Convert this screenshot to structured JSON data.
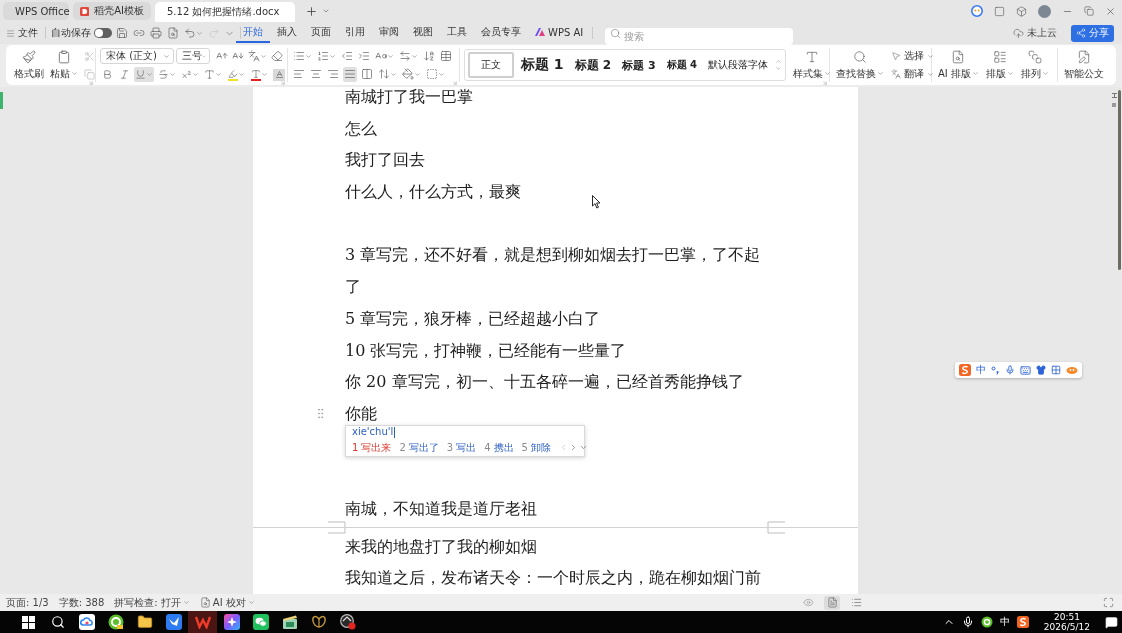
{
  "title_bar": {
    "tabs": [
      {
        "label": "WPS Office",
        "kind": "wps",
        "selected": false
      },
      {
        "label": "稻壳AI模板",
        "kind": "docer",
        "selected": false
      },
      {
        "label": "5.12 如何把握情绪.docx",
        "kind": "writer",
        "selected": true
      }
    ]
  },
  "quick_bar": {
    "file_menu": "文件",
    "autosave": {
      "label": "自动保存",
      "on": false
    },
    "history": [
      {
        "kind": "undo",
        "disabled": false
      },
      {
        "kind": "redo",
        "disabled": true
      }
    ]
  },
  "ribbon_tabs": [
    {
      "label": "开始",
      "kind": "text",
      "selected": true
    },
    {
      "label": "插入",
      "kind": "text",
      "selected": false
    },
    {
      "label": "页面",
      "kind": "text",
      "selected": false
    },
    {
      "label": "引用",
      "kind": "text",
      "selected": false
    },
    {
      "label": "审阅",
      "kind": "text",
      "selected": false
    },
    {
      "label": "视图",
      "kind": "text",
      "selected": false
    },
    {
      "label": "工具",
      "kind": "text",
      "selected": false
    },
    {
      "label": "会员专享",
      "kind": "text",
      "selected": false
    },
    {
      "label": "WPS AI",
      "kind": "ai",
      "selected": false
    }
  ],
  "search": {
    "placeholder": "搜索"
  },
  "cloud_status": "未上云",
  "share_button": "分享",
  "ribbon": {
    "clipboard": {
      "format_painter": "格式刷",
      "paste": "粘贴"
    },
    "font": {
      "family": "宋体 (正文)",
      "size": "三号",
      "toggles": [
        {
          "kind": "bold",
          "on": false
        },
        {
          "kind": "italic",
          "on": false
        },
        {
          "kind": "underline",
          "on": true
        }
      ]
    },
    "alignment": [
      {
        "kind": "left",
        "selected": false
      },
      {
        "kind": "center",
        "selected": false
      },
      {
        "kind": "right",
        "selected": false
      },
      {
        "kind": "justify",
        "selected": true
      },
      {
        "kind": "distributed",
        "selected": false
      }
    ],
    "styles": [
      {
        "label": "正文",
        "kind": "body",
        "selected": true
      },
      {
        "label": "标题 1",
        "kind": "heading1",
        "selected": false
      },
      {
        "label": "标题 2",
        "kind": "heading2",
        "selected": false
      },
      {
        "label": "标题 3",
        "kind": "heading3",
        "selected": false
      },
      {
        "label": "标题 4",
        "kind": "heading4",
        "selected": false
      },
      {
        "label": "默认段落字体",
        "kind": "plain",
        "selected": false
      }
    ],
    "style_set": "样式集",
    "find_replace": "查找替换",
    "select": "选择",
    "translate": "翻译",
    "ai_layout": "AI 排版",
    "layout": "排版",
    "arrange": "排列",
    "smart_document": "智能公文"
  },
  "document": {
    "pages": [
      {
        "lines": [
          {
            "kind": "text",
            "text": "南城打了我一巴掌"
          },
          {
            "kind": "text",
            "text": "怎么"
          },
          {
            "kind": "text",
            "text": "我打了回去"
          },
          {
            "kind": "text",
            "text": "什么人，什么方式，最爽"
          },
          {
            "kind": "blank"
          },
          {
            "kind": "text",
            "text": "3 章写完，还不好看，就是想到柳如烟去打一巴掌，了不起"
          },
          {
            "kind": "text",
            "text": "了"
          },
          {
            "kind": "text",
            "text": "5 章写完，狼牙棒，已经超越小白了"
          },
          {
            "kind": "text",
            "text": "10 张写完，打神鞭，已经能有一些量了"
          },
          {
            "kind": "text",
            "text": "你 20 章写完，初一、十五各碎一遍，已经首秀能挣钱了"
          },
          {
            "kind": "text",
            "text": "你能",
            "drag_handle": true,
            "ime_popup": {
              "composition": "xie'chu'l",
              "candidates": [
                {
                  "number": "1",
                  "text": "写出来",
                  "selected": true
                },
                {
                  "number": "2",
                  "text": "写出了",
                  "selected": false
                },
                {
                  "number": "3",
                  "text": "写出",
                  "selected": false
                },
                {
                  "number": "4",
                  "text": "携出",
                  "selected": false
                },
                {
                  "number": "5",
                  "text": "卸除",
                  "selected": false
                }
              ]
            }
          },
          {
            "kind": "blank"
          },
          {
            "kind": "blank"
          },
          {
            "kind": "text",
            "text": "南城，不知道我是道厅老祖"
          }
        ]
      },
      {
        "lines": [
          {
            "kind": "text",
            "text": "来我的地盘打了我的柳如烟"
          },
          {
            "kind": "text",
            "text": "我知道之后，发布诸天令：一个时辰之内，跪在柳如烟门前"
          }
        ]
      }
    ]
  },
  "ime_toolbar": {
    "mode": "中"
  },
  "status_bar": {
    "page": "页面: 1/3",
    "words": "字数: 388",
    "spell_check": "拼写检查: 打开",
    "proofread": "AI 校对"
  },
  "taskbar": {
    "apps": [
      {
        "kind": "cloud",
        "selected": false
      },
      {
        "kind": "browser",
        "selected": false
      },
      {
        "kind": "folder",
        "selected": false
      },
      {
        "kind": "bird",
        "selected": false
      },
      {
        "kind": "wps",
        "selected": true
      },
      {
        "kind": "sparkle",
        "selected": false
      },
      {
        "kind": "chat",
        "selected": false
      },
      {
        "kind": "media",
        "selected": false
      },
      {
        "kind": "butterfly",
        "selected": false
      },
      {
        "kind": "recorder",
        "selected": false
      }
    ],
    "input_mode": "中",
    "time": "20:51",
    "date": "2026/5/12"
  }
}
